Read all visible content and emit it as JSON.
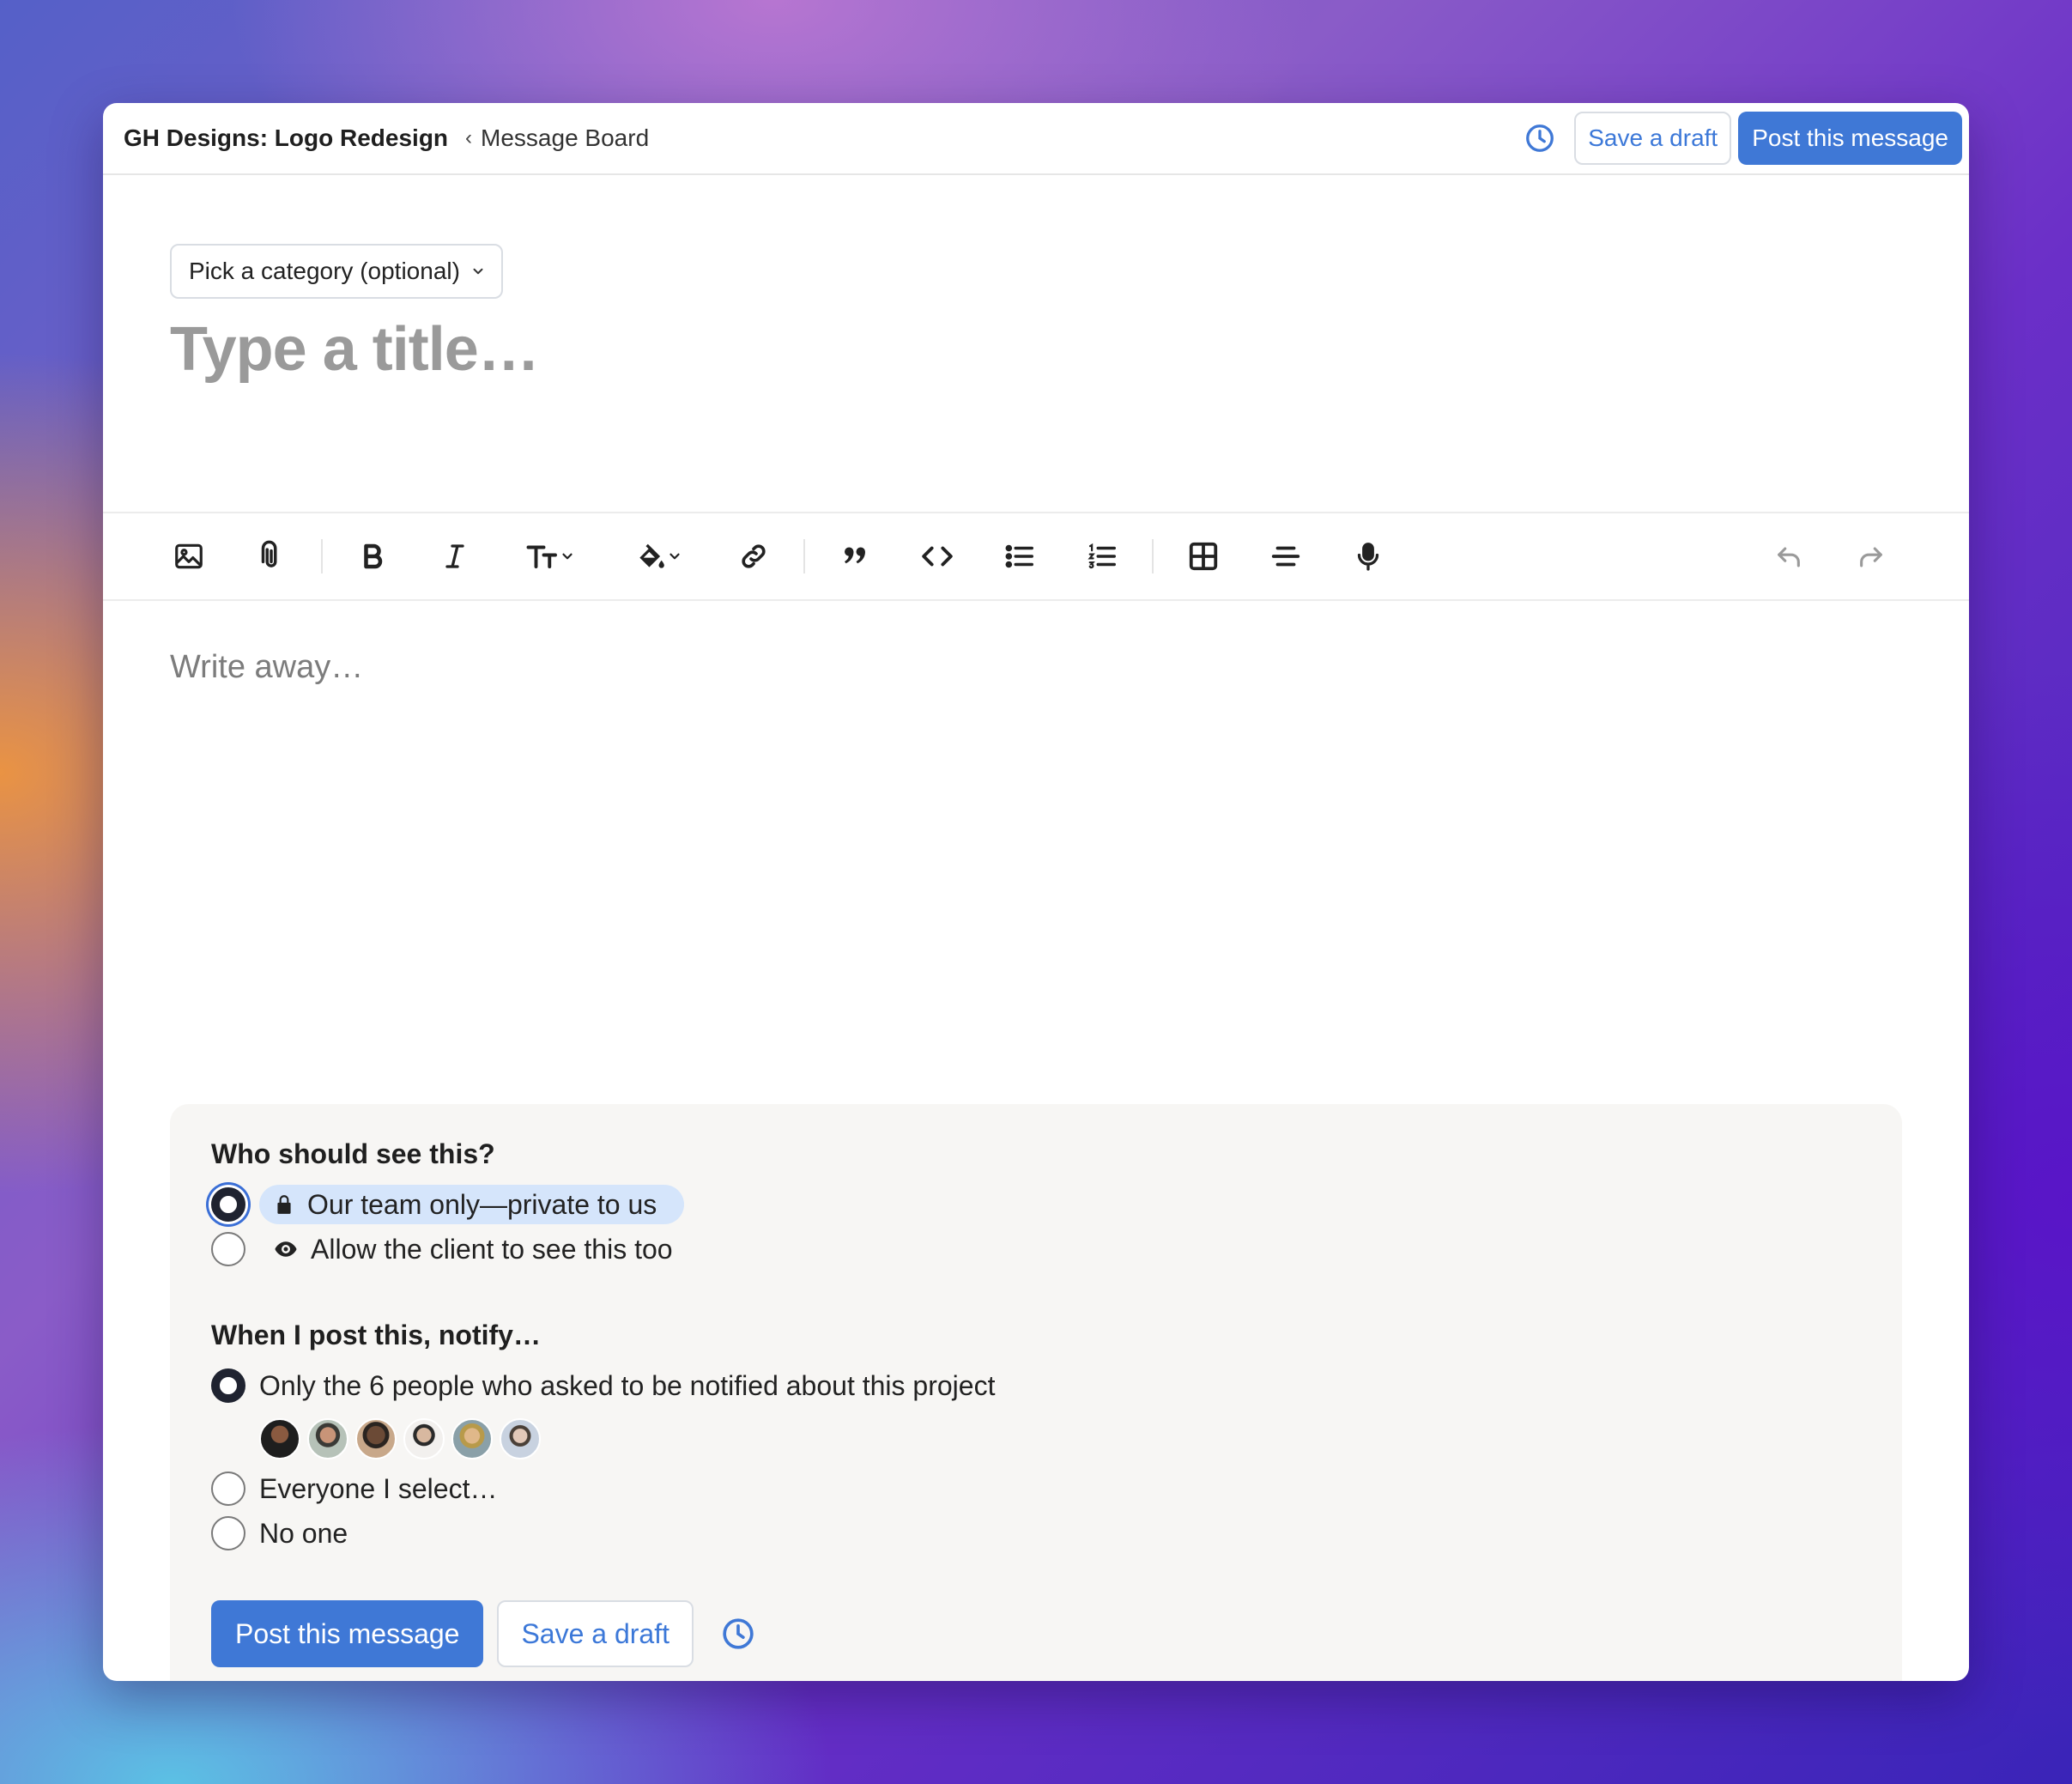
{
  "topbar": {
    "project_title": "GH Designs: Logo Redesign",
    "crumb_separator": "‹",
    "breadcrumb": "Message Board",
    "schedule_icon": "clock-icon",
    "save_draft_label": "Save a draft",
    "post_label": "Post this message"
  },
  "composer": {
    "category_label": "Pick a category (optional)",
    "title_placeholder": "Type a title…",
    "body_placeholder": "Write away…"
  },
  "toolbar": {
    "tools": [
      "image-icon",
      "paperclip-icon",
      "bold-icon",
      "italic-icon",
      "text-size-icon",
      "highlight-color-icon",
      "link-icon",
      "quote-icon",
      "code-icon",
      "bullet-list-icon",
      "numbered-list-icon",
      "table-icon",
      "horizontal-rule-icon",
      "microphone-icon",
      "undo-icon",
      "redo-icon"
    ]
  },
  "visibility": {
    "heading": "Who should see this?",
    "options": [
      {
        "label": "Our team only—private to us",
        "icon": "lock-icon",
        "selected": true
      },
      {
        "label": "Allow the client to see this too",
        "icon": "eye-icon",
        "selected": false
      }
    ]
  },
  "notify": {
    "heading": "When I post this, notify…",
    "options": [
      {
        "label": "Only the 6 people who asked to be notified about this project",
        "selected": true
      },
      {
        "label": "Everyone I select…",
        "selected": false
      },
      {
        "label": "No one",
        "selected": false
      }
    ],
    "avatar_colors": [
      "#2b2b2b",
      "#8a9a8c",
      "#6b4a36",
      "#e8e4e0",
      "#a8a07a",
      "#9aa4b4"
    ]
  },
  "footer": {
    "post_label": "Post this message",
    "save_draft_label": "Save a draft"
  },
  "colors": {
    "accent": "#3f78d6",
    "pill_bg": "#d5e5fb",
    "panel_bg": "#f7f6f4"
  }
}
